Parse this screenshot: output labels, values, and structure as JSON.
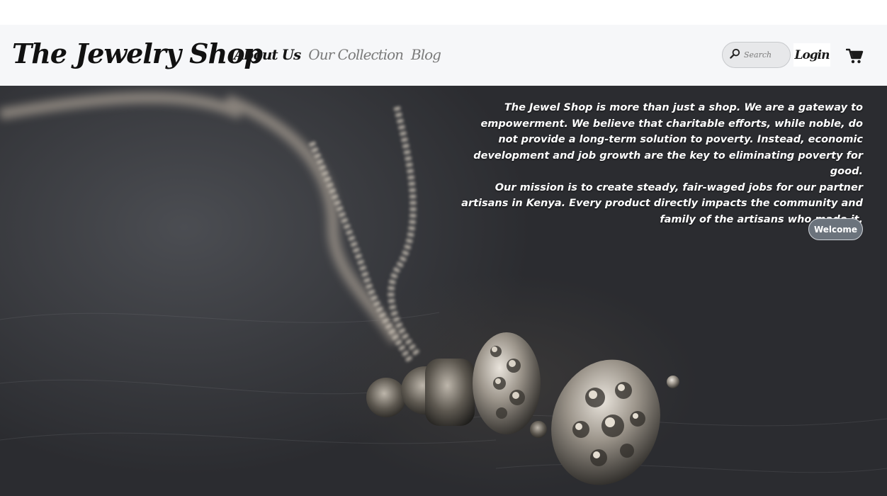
{
  "brand": {
    "name": "The Jewelry Shop"
  },
  "nav": {
    "links": [
      {
        "label": "About Us",
        "active": true
      },
      {
        "label": "Our Collection",
        "active": false
      },
      {
        "label": "Blog",
        "active": false
      }
    ]
  },
  "search": {
    "placeholder": "Search",
    "icon": "search-icon"
  },
  "login": {
    "label": "Login"
  },
  "cart": {
    "icon": "shopping-cart-icon"
  },
  "hero": {
    "paragraph_1": "The Jewel Shop is more than just a shop. We are a gateway to empowerment. We believe that charitable efforts, while noble, do not provide a long-term solution to poverty. Instead, economic development and job growth are the key to eliminating poverty for good.",
    "paragraph_2": "Our mission is to create steady, fair-waged jobs for our partner artisans in Kenya. Every product directly impacts the community and family of the artisans who made it.",
    "button_label": "Welcome"
  },
  "colors": {
    "navbar_bg": "#f6f7f9",
    "nav_active": "#151515",
    "nav_inactive": "#7a7a7a",
    "welcome_button_bg": "#6b737c",
    "hero_bg": "#2a2b2f"
  }
}
